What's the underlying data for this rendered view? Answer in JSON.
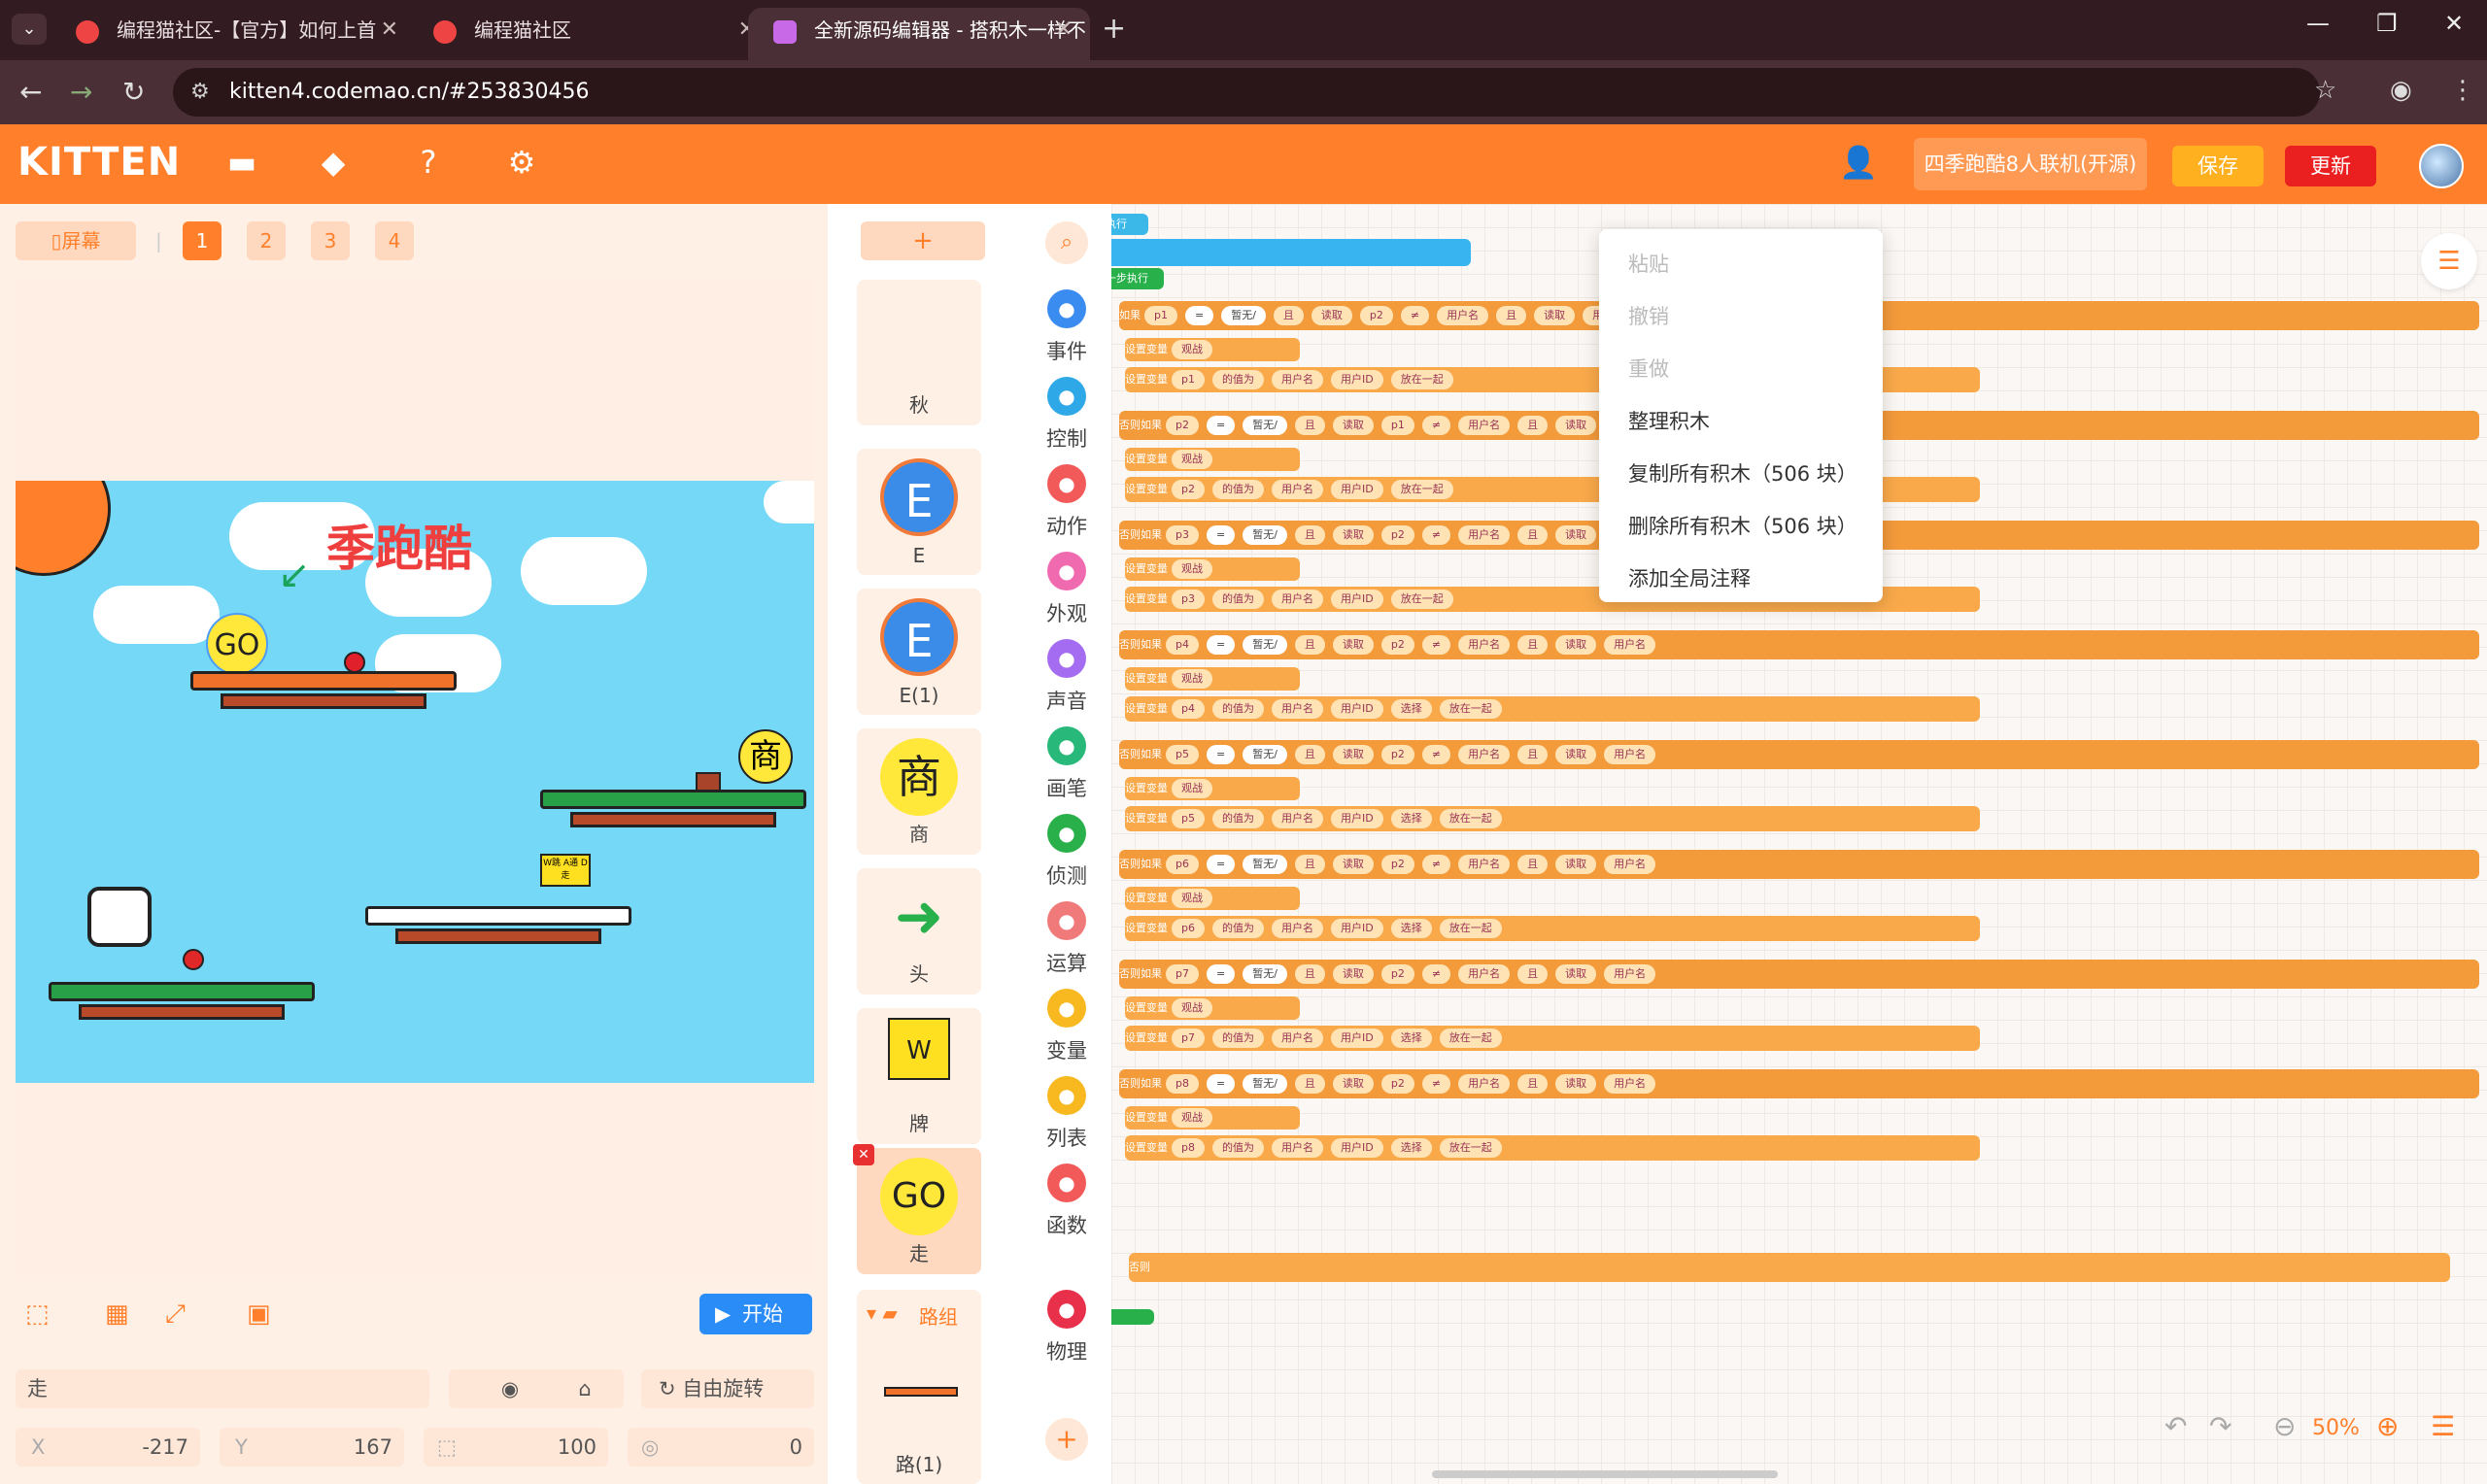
{
  "browser": {
    "tabs": [
      {
        "title": "编程猫社区-【官方】如何上首"
      },
      {
        "title": "编程猫社区"
      },
      {
        "title": "全新源码编辑器 - 搭积木一样不"
      }
    ],
    "url": "kitten4.codemao.cn/#253830456"
  },
  "header": {
    "logo": "KITTEN",
    "project_name": "四季跑酷8人联机(开源)",
    "save_label": "保存",
    "update_label": "更新"
  },
  "stage": {
    "screen_label": "屏幕",
    "screens": [
      "1",
      "2",
      "3",
      "4"
    ],
    "active_screen": "1",
    "scene_title": "季跑酷",
    "go_text": "GO",
    "shop_char": "商",
    "sign_text": "W跳 A通 D走",
    "start_label": "开始",
    "sprite_name": "走",
    "rotation_label": "自由旋转",
    "x_label": "X",
    "x_value": "-217",
    "y_label": "Y",
    "y_value": "167",
    "size_value": "100",
    "direction_value": "0"
  },
  "sprites": {
    "add_label": "+",
    "items": [
      {
        "name": "秋",
        "glyph": ""
      },
      {
        "name": "E",
        "glyph": "E"
      },
      {
        "name": "E(1)",
        "glyph": "E"
      },
      {
        "name": "商",
        "glyph": "商"
      },
      {
        "name": "头",
        "glyph": "➜"
      },
      {
        "name": "牌",
        "glyph": "W"
      },
      {
        "name": "走",
        "glyph": "GO"
      }
    ],
    "folder_label": "路组",
    "folder_item": "路(1)"
  },
  "categories": [
    {
      "label": "事件",
      "color": "#3b8cf0",
      "icon": "event-icon"
    },
    {
      "label": "控制",
      "color": "#2fa8e8",
      "icon": "control-icon"
    },
    {
      "label": "动作",
      "color": "#f25a5a",
      "icon": "motion-icon"
    },
    {
      "label": "外观",
      "color": "#f06ab0",
      "icon": "looks-icon"
    },
    {
      "label": "声音",
      "color": "#a46cf0",
      "icon": "sound-icon"
    },
    {
      "label": "画笔",
      "color": "#28b87a",
      "icon": "pen-icon"
    },
    {
      "label": "侦测",
      "color": "#2ab04a",
      "icon": "sensing-icon"
    },
    {
      "label": "运算",
      "color": "#f07a7a",
      "icon": "operator-icon"
    },
    {
      "label": "变量",
      "color": "#f8b820",
      "icon": "variable-icon"
    },
    {
      "label": "列表",
      "color": "#f8b820",
      "icon": "list-icon"
    },
    {
      "label": "函数",
      "color": "#f25a5a",
      "icon": "function-icon"
    },
    {
      "label": "物理",
      "color": "#e8304a",
      "icon": "physics-icon"
    }
  ],
  "code": {
    "hat_label": "执行",
    "step_label": "一步执行",
    "if_label": "如果",
    "elseif_label": "否则如果",
    "else_label": "否则",
    "set_label": "设置变量",
    "value_label": "的值为",
    "read_label": "读取",
    "equals_label": "=",
    "notequal_label": "≠",
    "and_label": "且",
    "username_label": "用户名",
    "userid_label": "用户ID",
    "empty_label": "暂无/",
    "watch_label": "观战",
    "join_label": "放在一起",
    "select_label": "选择",
    "rows": [
      {
        "var": "p1",
        "cmp": "p2"
      },
      {
        "var": "p2",
        "cmp": "p1"
      },
      {
        "var": "p3",
        "cmp": "p2"
      },
      {
        "var": "p4",
        "cmp": "p2"
      },
      {
        "var": "p5",
        "cmp": "p2"
      },
      {
        "var": "p6",
        "cmp": "p2"
      },
      {
        "var": "p7",
        "cmp": "p2"
      },
      {
        "var": "p8",
        "cmp": "p2"
      }
    ]
  },
  "context_menu": {
    "items": [
      {
        "label": "粘贴",
        "enabled": false
      },
      {
        "label": "撤销",
        "enabled": false
      },
      {
        "label": "重做",
        "enabled": false
      },
      {
        "label": "整理积木",
        "enabled": true
      },
      {
        "label": "复制所有积木（506 块）",
        "enabled": true
      },
      {
        "label": "删除所有积木（506 块）",
        "enabled": true
      },
      {
        "label": "添加全局注释",
        "enabled": true
      }
    ]
  },
  "zoom": {
    "level": "50%"
  }
}
